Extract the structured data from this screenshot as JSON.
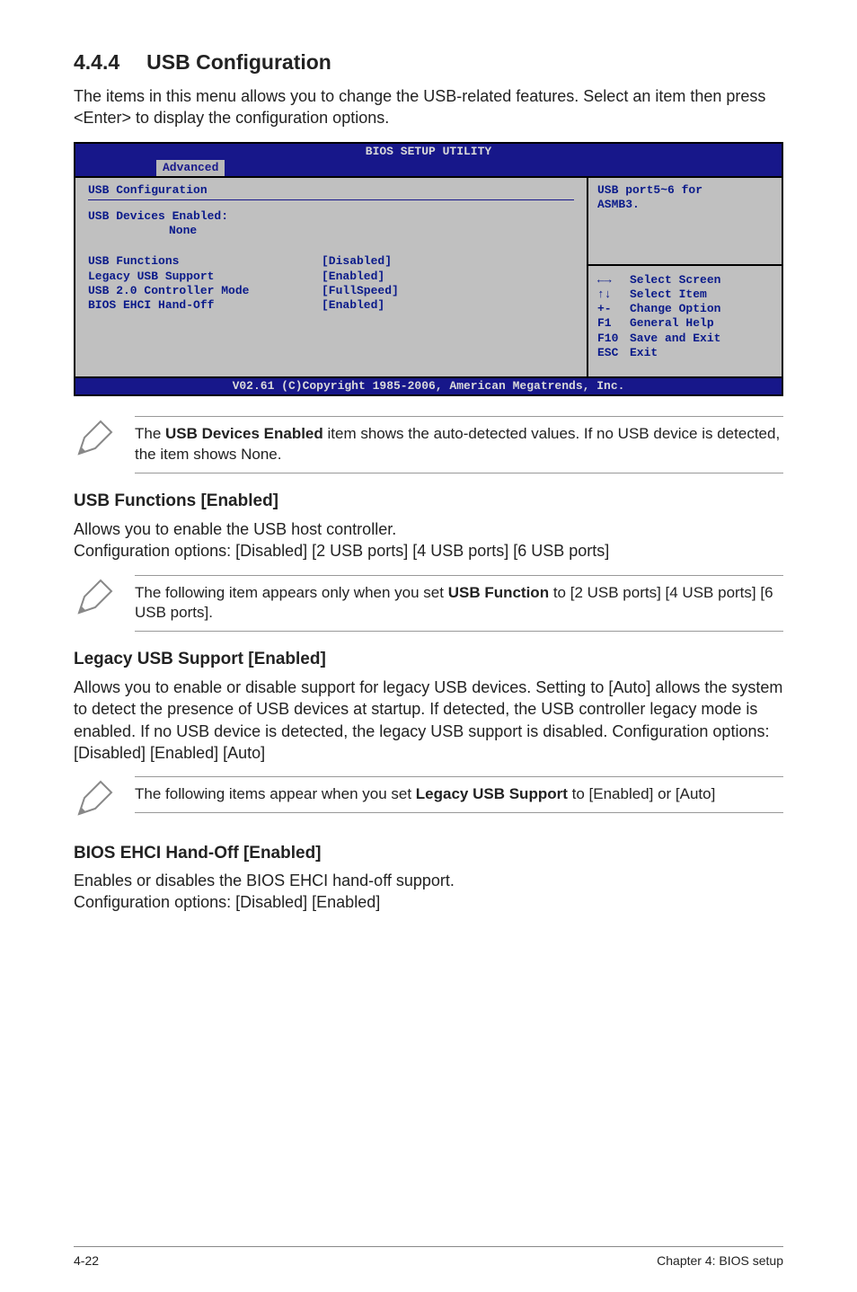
{
  "section": {
    "number": "4.4.4",
    "title": "USB Configuration",
    "intro": "The items in this menu allows you to change the USB-related features. Select an item then press <Enter> to display the configuration options."
  },
  "bios": {
    "title": "BIOS SETUP UTILITY",
    "tab": "Advanced",
    "heading": "USB Configuration",
    "devices_label": "USB Devices Enabled:",
    "devices_value": "None",
    "items": [
      {
        "label": "USB Functions",
        "value": "[Disabled]"
      },
      {
        "label": "Legacy USB Support",
        "value": "[Enabled]"
      },
      {
        "label": "USB 2.0 Controller Mode",
        "value": "[FullSpeed]"
      },
      {
        "label": "BIOS EHCI Hand-Off",
        "value": "[Enabled]"
      }
    ],
    "help_top_line1": "USB port5~6 for",
    "help_top_line2": "ASMB3.",
    "help_keys": [
      {
        "k": "←→",
        "t": "Select Screen"
      },
      {
        "k": "↑↓",
        "t": "Select Item"
      },
      {
        "k": "+-",
        "t": "Change Option"
      },
      {
        "k": "F1",
        "t": "General Help"
      },
      {
        "k": "F10",
        "t": "Save and Exit"
      },
      {
        "k": "ESC",
        "t": "Exit"
      }
    ],
    "copyright": "V02.61 (C)Copyright 1985-2006, American Megatrends, Inc."
  },
  "note1_pre": "The ",
  "note1_bold": "USB Devices Enabled",
  "note1_post": " item shows the auto-detected values. If no USB device is detected, the item shows None.",
  "sub1": {
    "heading": "USB Functions [Enabled]",
    "line1": "Allows you to enable the USB host controller.",
    "line2": "Configuration options: [Disabled] [2 USB ports] [4 USB ports] [6 USB ports]"
  },
  "note2_pre": "The following item appears only when you set ",
  "note2_bold": "USB Function",
  "note2_post": " to [2 USB ports] [4 USB ports] [6 USB ports].",
  "sub2": {
    "heading": "Legacy USB Support [Enabled]",
    "body": "Allows you to enable or disable support for legacy USB devices. Setting to [Auto] allows the system to detect the presence of USB devices at startup. If detected, the USB controller legacy mode is enabled. If no USB device is detected, the legacy USB support is disabled. Configuration options: [Disabled] [Enabled] [Auto]"
  },
  "note3_pre": "The following items appear when you set ",
  "note3_bold": "Legacy USB Support",
  "note3_post": " to [Enabled] or [Auto]",
  "sub3": {
    "heading": "BIOS EHCI Hand-Off [Enabled]",
    "line1": "Enables or disables the BIOS EHCI hand-off support.",
    "line2": "Configuration options: [Disabled] [Enabled]"
  },
  "footer": {
    "left": "4-22",
    "right": "Chapter 4: BIOS setup"
  }
}
